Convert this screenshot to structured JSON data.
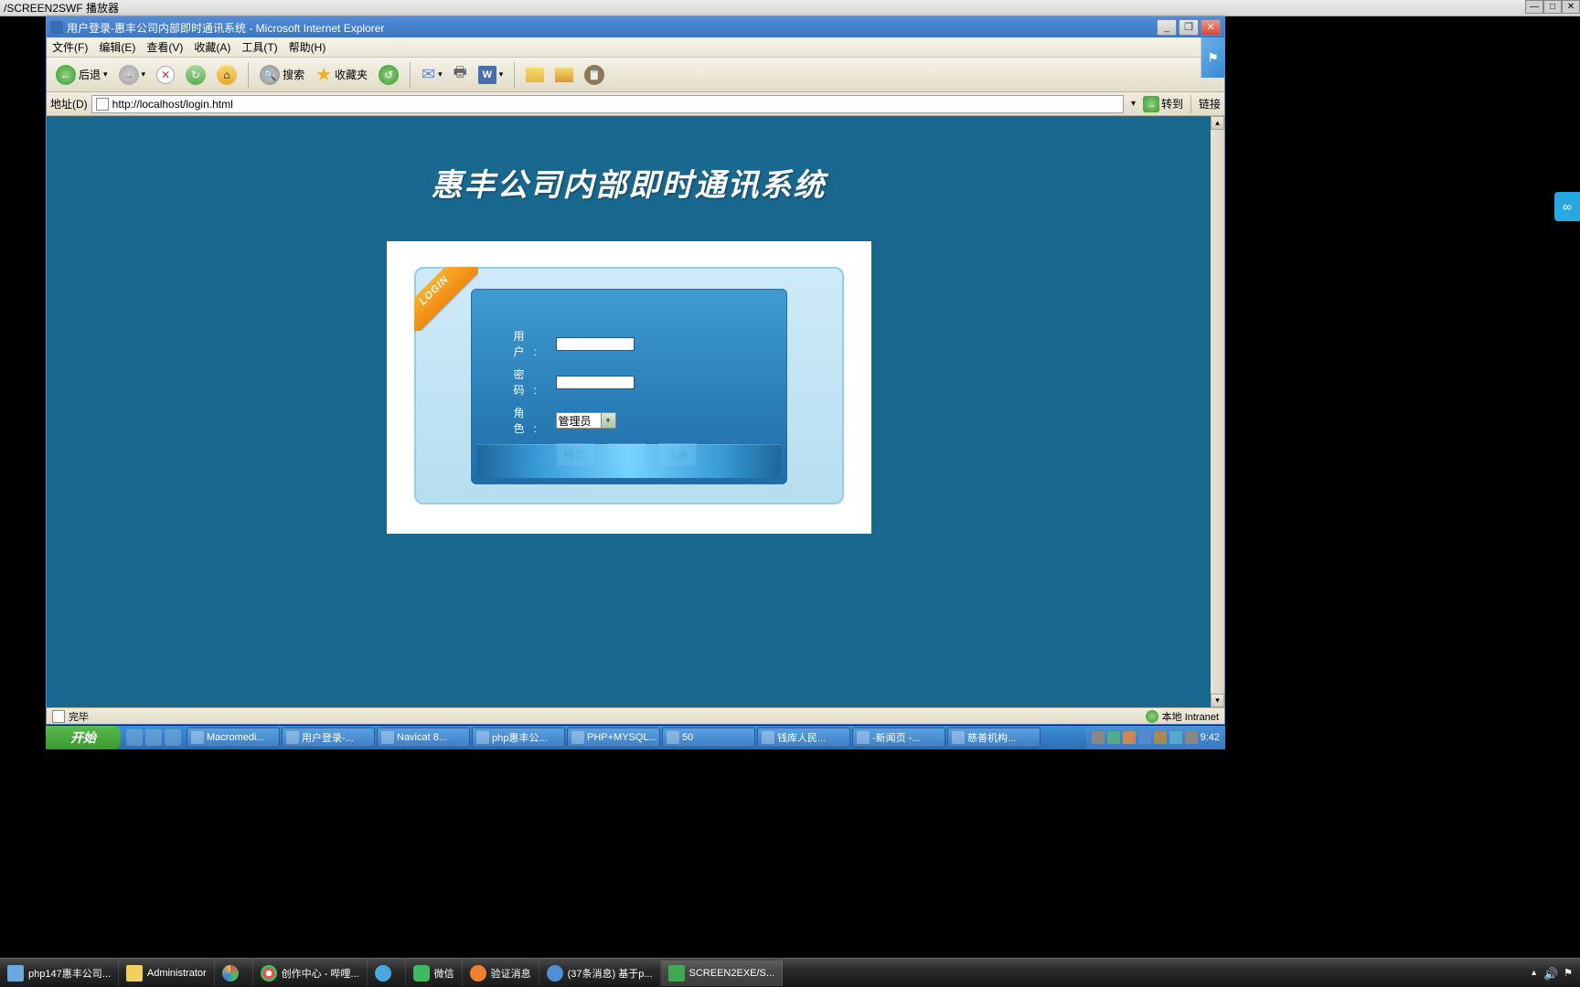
{
  "player": {
    "title": "/SCREEN2SWF 播放器"
  },
  "ie": {
    "title": "用户登录-惠丰公司内部即时通讯系统 - Microsoft Internet Explorer",
    "menus": [
      "文件(F)",
      "编辑(E)",
      "查看(V)",
      "收藏(A)",
      "工具(T)",
      "帮助(H)"
    ],
    "toolbar": {
      "back": "后退",
      "search": "搜索",
      "favorites": "收藏夹"
    },
    "address": {
      "label": "地址(D)",
      "url": "http://localhost/login.html",
      "go": "转到",
      "links": "链接"
    },
    "status": {
      "left": "完毕",
      "right": "本地 Intranet"
    }
  },
  "page": {
    "heading": "惠丰公司内部即时通讯系统",
    "ribbon": "LOGIN",
    "form": {
      "user_label": "用 户:",
      "pass_label": "密 码:",
      "role_label": "角 色:",
      "role_value": "管理员",
      "submit": "提交",
      "reset": "重置",
      "register": "注册"
    }
  },
  "inner_taskbar": {
    "start": "开始",
    "tasks": [
      "Macromedi...",
      "用户登录-...",
      "Navicat 8...",
      "php惠丰公...",
      "PHP+MYSQL...",
      "50",
      "钱库人民...",
      "-新闻页 -...",
      "慈善机构..."
    ],
    "clock": "9:42"
  },
  "outer_taskbar": {
    "tasks": [
      {
        "label": "php147惠丰公司...",
        "color": "#6aa8e0"
      },
      {
        "label": "Administrator",
        "color": "#f0d060"
      },
      {
        "label": "",
        "color": "#40c060"
      },
      {
        "label": "创作中心 - 哔哩...",
        "color": "#e85050"
      },
      {
        "label": "",
        "color": "#4aa8e0"
      },
      {
        "label": "微信",
        "color": "#40b860"
      },
      {
        "label": "验证消息",
        "color": "#f08030"
      },
      {
        "label": "(37条消息) 基于p...",
        "color": "#5090d0"
      },
      {
        "label": "SCREEN2EXE/S...",
        "color": "#40a850"
      }
    ]
  },
  "right_widget": "∞"
}
